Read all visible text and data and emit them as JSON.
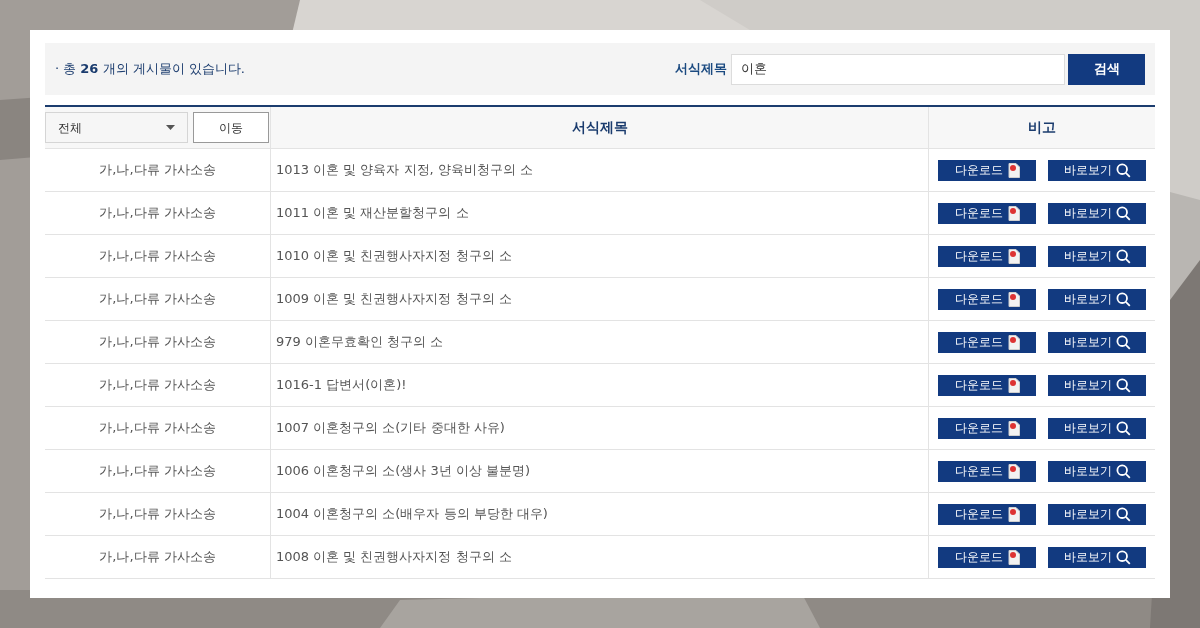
{
  "summary": {
    "bullet": "·",
    "text": "총 **26** 개의 게시물이 있습니다."
  },
  "search": {
    "label": "서식제목",
    "value": "이혼",
    "button": "검색"
  },
  "table": {
    "filter": {
      "value": "전체"
    },
    "move_button": "이동",
    "columns": [
      "서식제목",
      "비고"
    ],
    "rows": [
      {
        "category": "가,나,다류 가사소송",
        "title": "1013 이혼 및 양육자 지정, 양육비청구의 소",
        "download": "다운로드",
        "view": "바로보기"
      },
      {
        "category": "가,나,다류 가사소송",
        "title": "1011 이혼 및 재산분할청구의 소",
        "download": "다운로드",
        "view": "바로보기"
      },
      {
        "category": "가,나,다류 가사소송",
        "title": "1010 이혼 및 친권행사자지정 청구의 소",
        "download": "다운로드",
        "view": "바로보기"
      },
      {
        "category": "가,나,다류 가사소송",
        "title": "1009 이혼 및 친권행사자지정 청구의 소",
        "download": "다운로드",
        "view": "바로보기"
      },
      {
        "category": "가,나,다류 가사소송",
        "title": "979 이혼무효확인 청구의 소",
        "download": "다운로드",
        "view": "바로보기"
      },
      {
        "category": "가,나,다류 가사소송",
        "title": "1016-1 답변서(이혼)!",
        "download": "다운로드",
        "view": "바로보기"
      },
      {
        "category": "가,나,다류 가사소송",
        "title": "1007 이혼청구의 소(기타 중대한 사유)",
        "download": "다운로드",
        "view": "바로보기"
      },
      {
        "category": "가,나,다류 가사소송",
        "title": "1006 이혼청구의 소(생사 3년 이상 불분명)",
        "download": "다운로드",
        "view": "바로보기"
      },
      {
        "category": "가,나,다류 가사소송",
        "title": "1004 이혼청구의 소(배우자 등의 부당한 대우)",
        "download": "다운로드",
        "view": "바로보기"
      },
      {
        "category": "가,나,다류 가사소송",
        "title": "1008 이혼 및 친권행사자지정 청구의 소",
        "download": "다운로드",
        "view": "바로보기"
      }
    ]
  }
}
